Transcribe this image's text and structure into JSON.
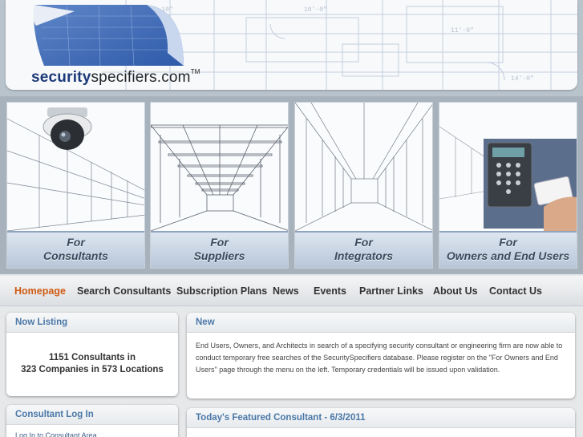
{
  "brand": {
    "logo_part1": "security",
    "logo_part2": "specifiers.com",
    "logo_tm": "TM"
  },
  "banner": {
    "tiles": [
      {
        "line1": "For",
        "line2": "Consultants"
      },
      {
        "line1": "For",
        "line2": "Suppliers"
      },
      {
        "line1": "For",
        "line2": "Integrators"
      },
      {
        "line1": "For",
        "line2": "Owners and End Users"
      }
    ]
  },
  "nav": {
    "items": [
      {
        "label": "Homepage",
        "active": true
      },
      {
        "label": "Search Consultants"
      },
      {
        "label": "Subscription Plans"
      },
      {
        "label": "News"
      },
      {
        "label": "Events"
      },
      {
        "label": "Partner Links"
      },
      {
        "label": "About Us"
      },
      {
        "label": "Contact Us"
      }
    ]
  },
  "now_listing": {
    "title": "Now Listing",
    "line1": "1151 Consultants in",
    "line2": "323 Companies in 573 Locations"
  },
  "news": {
    "title": "New",
    "text": "End Users, Owners, and Architects in search of a specifying security consultant or engineering firm are now able to conduct temporary free searches of the SecuritySpecifiers database. Please register on the \"For Owners and End Users\" page through the menu on the left. Temporary credentials will be issued upon validation."
  },
  "consultant_login": {
    "title": "Consultant Log In",
    "link": "Log In to Consultant Area"
  },
  "featured": {
    "title": "Today's Featured Consultant - 6/3/2011"
  },
  "colors": {
    "accent": "#d05a12",
    "box_title": "#4b78a8",
    "logo_blue": "#1d3a78"
  },
  "icons": [
    "blueprint-sheet-icon",
    "security-camera-icon",
    "keypad-reader-icon"
  ]
}
